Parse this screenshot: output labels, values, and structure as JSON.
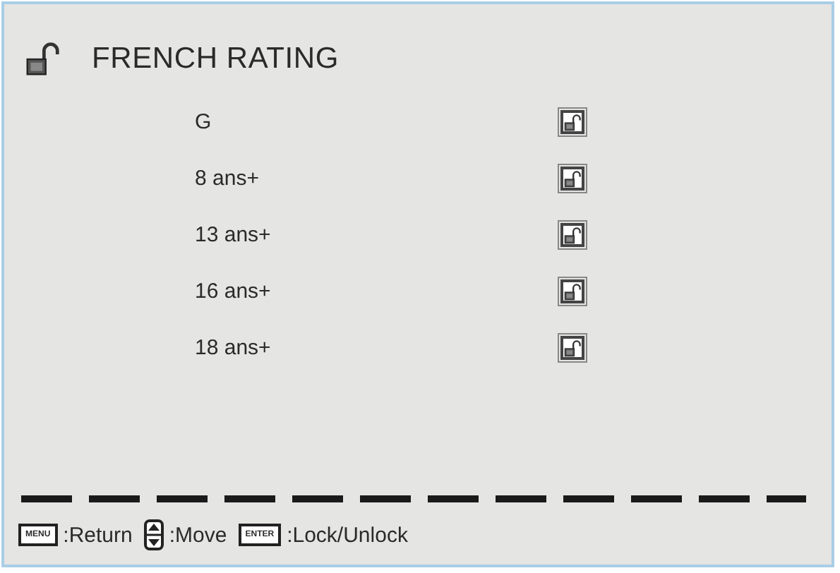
{
  "title": "FRENCH RATING",
  "header_locked": false,
  "ratings": [
    {
      "label": "G",
      "locked": false
    },
    {
      "label": "8 ans+",
      "locked": false
    },
    {
      "label": "13 ans+",
      "locked": false
    },
    {
      "label": "16 ans+",
      "locked": false
    },
    {
      "label": "18 ans+",
      "locked": false
    }
  ],
  "hints": [
    {
      "kind": "key",
      "key": "MENU",
      "action": ":Return"
    },
    {
      "kind": "arrows",
      "action": ":Move"
    },
    {
      "kind": "key",
      "key": "ENTER",
      "action": ":Lock/Unlock"
    }
  ]
}
